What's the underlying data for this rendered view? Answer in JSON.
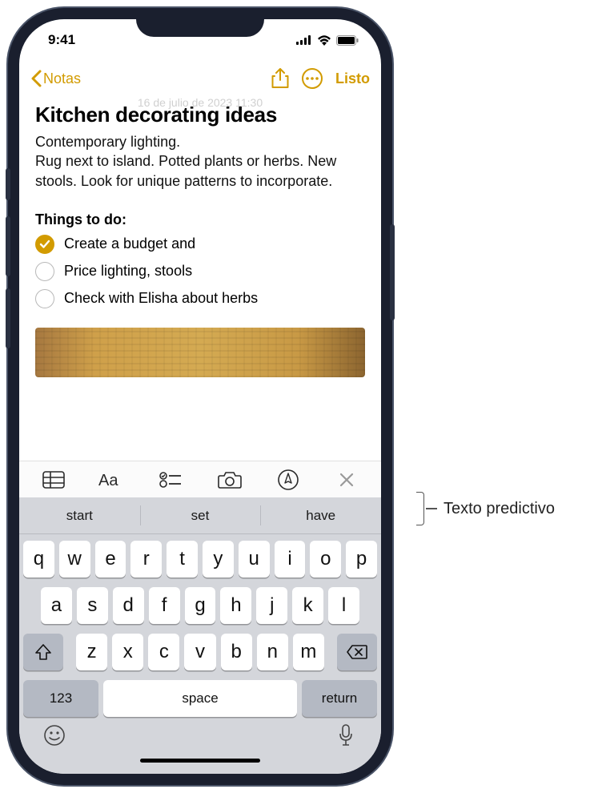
{
  "status": {
    "time": "9:41"
  },
  "nav": {
    "back_label": "Notas",
    "done_label": "Listo",
    "timestamp": "16 de julio de 2023  11:30"
  },
  "note": {
    "title": "Kitchen decorating ideas",
    "body": "Contemporary lighting.\nRug next to island.  Potted plants or herbs.  New stools. Look for unique patterns to incorporate.",
    "subhead": "Things to do:",
    "checklist": [
      {
        "label": "Create a budget and",
        "checked": true
      },
      {
        "label": "Price lighting, stools",
        "checked": false
      },
      {
        "label": "Check with Elisha about herbs",
        "checked": false
      }
    ]
  },
  "predictive": [
    "start",
    "set",
    "have"
  ],
  "keyboard": {
    "row1": [
      "q",
      "w",
      "e",
      "r",
      "t",
      "y",
      "u",
      "i",
      "o",
      "p"
    ],
    "row2": [
      "a",
      "s",
      "d",
      "f",
      "g",
      "h",
      "j",
      "k",
      "l"
    ],
    "row3": [
      "z",
      "x",
      "c",
      "v",
      "b",
      "n",
      "m"
    ],
    "num_label": "123",
    "space_label": "space",
    "return_label": "return"
  },
  "callout": {
    "label": "Texto predictivo"
  }
}
